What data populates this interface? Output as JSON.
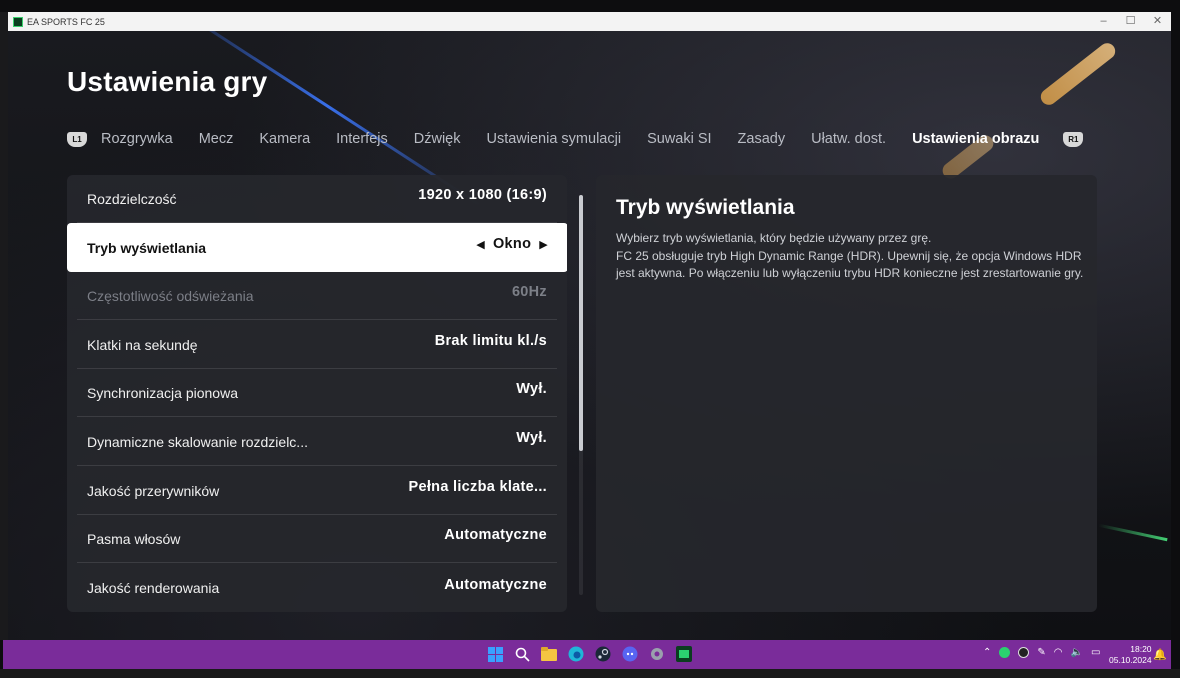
{
  "window": {
    "title": "EA SPORTS FC 25",
    "controls": [
      "–",
      "☐",
      "✕"
    ]
  },
  "page": {
    "title": "Ustawienia gry"
  },
  "tabs": {
    "left_bumper": "L1",
    "right_bumper": "R1",
    "items": [
      {
        "label": "Rozgrywka",
        "active": false
      },
      {
        "label": "Mecz",
        "active": false
      },
      {
        "label": "Kamera",
        "active": false
      },
      {
        "label": "Interfejs",
        "active": false
      },
      {
        "label": "Dźwięk",
        "active": false
      },
      {
        "label": "Ustawienia symulacji",
        "active": false
      },
      {
        "label": "Suwaki SI",
        "active": false
      },
      {
        "label": "Zasady",
        "active": false
      },
      {
        "label": "Ułatw. dost.",
        "active": false
      },
      {
        "label": "Ustawienia obrazu",
        "active": true
      }
    ]
  },
  "settings": [
    {
      "label": "Rozdzielczość",
      "value": "1920 x 1080 (16:9)",
      "state": "normal"
    },
    {
      "label": "Tryb wyświetlania",
      "value": "Okno",
      "state": "selected"
    },
    {
      "label": "Częstotliwość odświeżania",
      "value": "60Hz",
      "state": "disabled"
    },
    {
      "label": "Klatki na sekundę",
      "value": "Brak limitu kl./s",
      "state": "normal"
    },
    {
      "label": "Synchronizacja pionowa",
      "value": "Wył.",
      "state": "normal"
    },
    {
      "label": "Dynamiczne skalowanie rozdzielc...",
      "value": "Wył.",
      "state": "normal"
    },
    {
      "label": "Jakość przerywników",
      "value": "Pełna liczba klate...",
      "state": "normal"
    },
    {
      "label": "Pasma włosów",
      "value": "Automatyczne",
      "state": "normal"
    },
    {
      "label": "Jakość renderowania",
      "value": "Automatyczne",
      "state": "normal"
    }
  ],
  "description": {
    "title": "Tryb wyświetlania",
    "line1": "Wybierz tryb wyświetlania, który będzie używany przez grę.",
    "line2": "FC 25 obsługuje tryb High Dynamic Range (HDR). Upewnij się, że opcja Windows HDR jest aktywna. Po włączeniu lub wyłączeniu trybu HDR konieczne jest zrestartowanie gry."
  },
  "taskbar": {
    "apps": [
      {
        "name": "start-icon",
        "color": "#3aa0ff"
      },
      {
        "name": "search-icon",
        "color": "#ffffff"
      },
      {
        "name": "file-explorer-icon",
        "color": "#f5c542"
      },
      {
        "name": "edge-icon",
        "color": "#1fb6d8"
      },
      {
        "name": "steam-icon",
        "color": "#cfd6e0"
      },
      {
        "name": "discord-icon",
        "color": "#5865f2"
      },
      {
        "name": "settings-icon",
        "color": "#c9c9d3"
      },
      {
        "name": "fc25-icon",
        "color": "#2bd16f"
      }
    ],
    "clock_time": "18:20",
    "clock_date": "05.10.2024"
  },
  "colors": {
    "accent_purple": "#7a2c9a",
    "panel": "#26272c",
    "selected_row": "#ffffff"
  }
}
